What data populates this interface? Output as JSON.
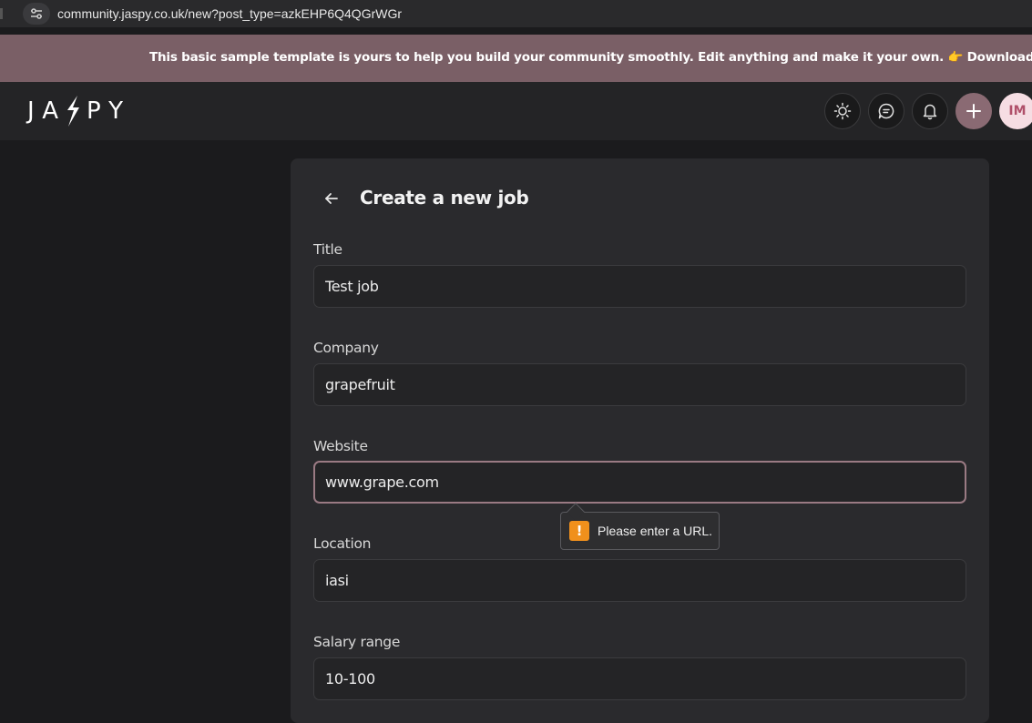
{
  "browser": {
    "url": "community.jaspy.co.uk/new?post_type=azkEHP6Q4QGrWGr"
  },
  "banner": {
    "text": "This basic sample template is yours to help you build your community smoothly. Edit anything and make it your own. 👉 Download Design Assets Style G"
  },
  "header": {
    "logo": "JASPY",
    "buttons": [
      "sun-icon",
      "chat-icon",
      "bell-icon",
      "plus-icon"
    ],
    "avatar_initials": "IM"
  },
  "form": {
    "title": "Create a new job",
    "fields": [
      {
        "label": "Title",
        "value": "Test job"
      },
      {
        "label": "Company",
        "value": "grapefruit"
      },
      {
        "label": "Website",
        "value": "www.grape.com"
      },
      {
        "label": "Location",
        "value": "iasi"
      },
      {
        "label": "Salary range",
        "value": "10-100"
      }
    ],
    "validation_message": "Please enter a URL."
  },
  "colors": {
    "banner": "#7a5f66",
    "accent": "#8a6a73",
    "warning": "#f0901c"
  }
}
